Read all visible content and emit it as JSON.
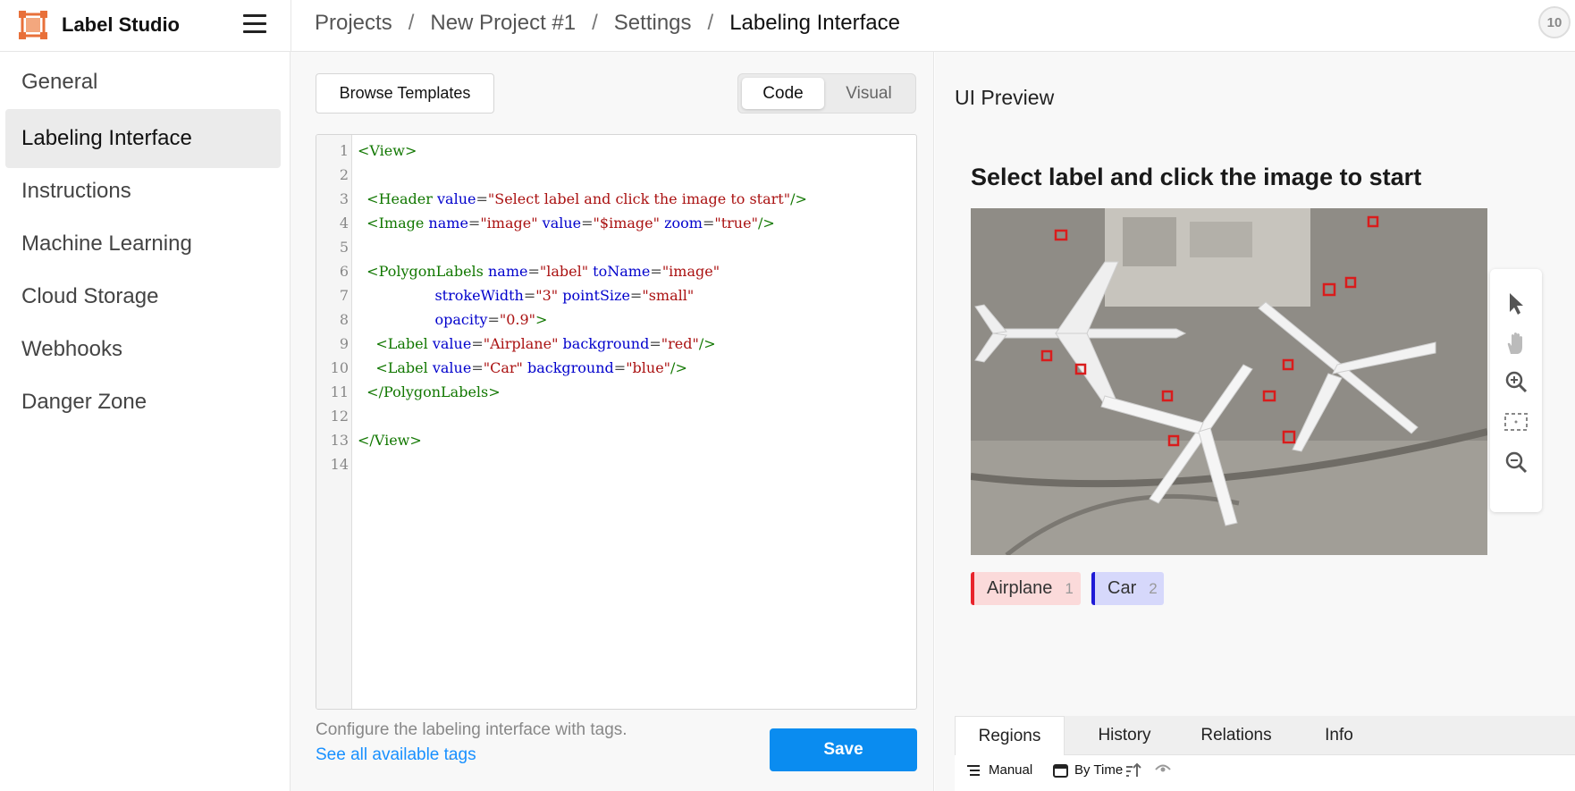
{
  "app": {
    "name": "Label Studio"
  },
  "breadcrumb": [
    {
      "label": "Projects"
    },
    {
      "label": "New Project #1"
    },
    {
      "label": "Settings"
    },
    {
      "label": "Labeling Interface"
    }
  ],
  "breadcrumb_separator": "/",
  "user": {
    "avatar_text": "10"
  },
  "sidebar": {
    "items": [
      {
        "label": "General",
        "active": false
      },
      {
        "label": "Labeling Interface",
        "active": true
      },
      {
        "label": "Instructions",
        "active": false
      },
      {
        "label": "Machine Learning",
        "active": false
      },
      {
        "label": "Cloud Storage",
        "active": false
      },
      {
        "label": "Webhooks",
        "active": false
      },
      {
        "label": "Danger Zone",
        "active": false
      }
    ]
  },
  "editor": {
    "browse_label": "Browse Templates",
    "mode_code": "Code",
    "mode_visual": "Visual",
    "active_mode": "Code",
    "line_numbers": [
      "1",
      "2",
      "3",
      "4",
      "5",
      "6",
      "7",
      "8",
      "9",
      "10",
      "11",
      "12",
      "13",
      "14"
    ],
    "code_lines": [
      "<View>",
      "",
      "  <Header value=\"Select label and click the image to start\"/>",
      "  <Image name=\"image\" value=\"$image\" zoom=\"true\"/>",
      "",
      "  <PolygonLabels name=\"label\" toName=\"image\"",
      "                 strokeWidth=\"3\" pointSize=\"small\"",
      "                 opacity=\"0.9\">",
      "    <Label value=\"Airplane\" background=\"red\"/>",
      "    <Label value=\"Car\" background=\"blue\"/>",
      "  </PolygonLabels>",
      "",
      "</View>",
      ""
    ],
    "hint_text": "Configure the labeling interface with tags.",
    "hint_link": "See all available tags",
    "hint_period": ".",
    "save_label": "Save"
  },
  "preview": {
    "title": "UI Preview",
    "header": "Select label and click the image to start",
    "labels": [
      {
        "name": "Airplane",
        "hotkey": "1",
        "color": "#e8242c"
      },
      {
        "name": "Car",
        "hotkey": "2",
        "color": "#1f1bd6"
      }
    ],
    "tools": [
      "pointer-icon",
      "hand-icon",
      "zoom-in-icon",
      "fit-screen-icon",
      "zoom-out-icon"
    ],
    "tabs": [
      {
        "label": "Regions",
        "active": true
      },
      {
        "label": "History",
        "active": false
      },
      {
        "label": "Relations",
        "active": false
      },
      {
        "label": "Info",
        "active": false
      }
    ],
    "group_mode": "Manual",
    "order_mode": "By Time"
  },
  "colors": {
    "accent": "#0a8cf0",
    "logo": "#e8703a",
    "link": "#1890ff"
  }
}
